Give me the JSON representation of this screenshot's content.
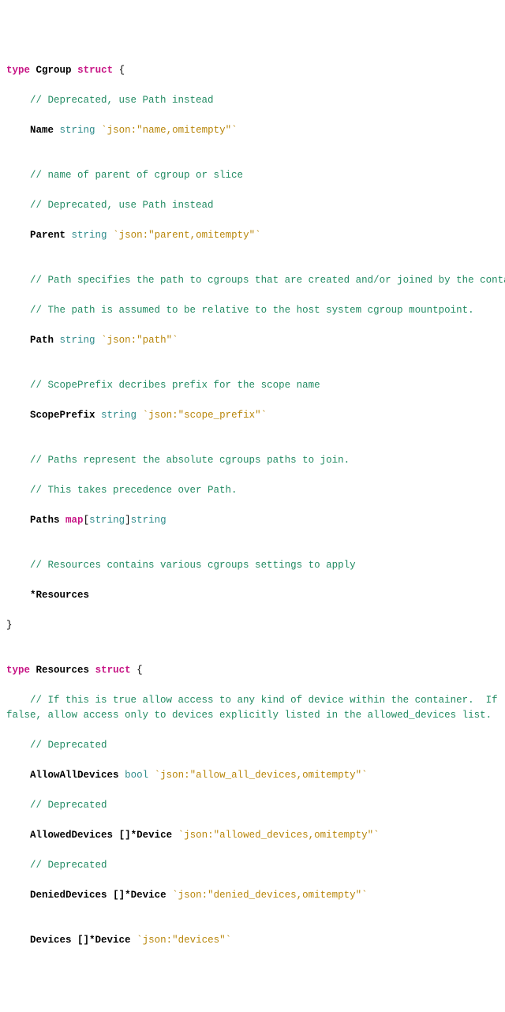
{
  "l1_kw1": "type",
  "l1_name": "Cgroup",
  "l1_kw2": "struct",
  "l1_brace": "{",
  "l2": "// Deprecated, use Path instead",
  "l3_name": "Name",
  "l3_typ": "string",
  "l3_tag": "`json:\"name,omitempty\"`",
  "l4": "",
  "l5": "// name of parent of cgroup or slice",
  "l6": "// Deprecated, use Path instead",
  "l7_name": "Parent",
  "l7_typ": "string",
  "l7_tag": "`json:\"parent,omitempty\"`",
  "l8": "",
  "l9": "// Path specifies the path to cgroups that are created and/or joined by the container.",
  "l10": "// The path is assumed to be relative to the host system cgroup mountpoint.",
  "l11_name": "Path",
  "l11_typ": "string",
  "l11_tag": "`json:\"path\"`",
  "l12": "",
  "l13": "// ScopePrefix decribes prefix for the scope name",
  "l14_name": "ScopePrefix",
  "l14_typ": "string",
  "l14_tag": "`json:\"scope_prefix\"`",
  "l15": "",
  "l16": "// Paths represent the absolute cgroups paths to join.",
  "l17": "// This takes precedence over Path.",
  "l18_name": "Paths",
  "l18_map": "map",
  "l18_lb": "[",
  "l18_key": "string",
  "l18_rb": "]",
  "l18_val": "string",
  "l19": "",
  "l20": "// Resources contains various cgroups settings to apply",
  "l21": "*Resources",
  "l22": "}",
  "l23": "",
  "l24_kw1": "type",
  "l24_name": "Resources",
  "l24_kw2": "struct",
  "l24_brace": "{",
  "l25": "// If this is true allow access to any kind of device within the container.  If false, allow access only to devices explicitly listed in the allowed_devices list.",
  "l26": "// Deprecated",
  "l27_name": "AllowAllDevices",
  "l27_typ": "bool",
  "l27_tag": "`json:\"allow_all_devices,omitempty\"`",
  "l28": "// Deprecated",
  "l29_name": "AllowedDevices",
  "l29_slice": "[]*Device",
  "l29_tag": "`json:\"allowed_devices,omitempty\"`",
  "l30": "// Deprecated",
  "l31_name": "DeniedDevices",
  "l31_slice": "[]*Device",
  "l31_tag": "`json:\"denied_devices,omitempty\"`",
  "l32": "",
  "l33_name": "Devices",
  "l33_slice": "[]*Device",
  "l33_tag": "`json:\"devices\"`"
}
